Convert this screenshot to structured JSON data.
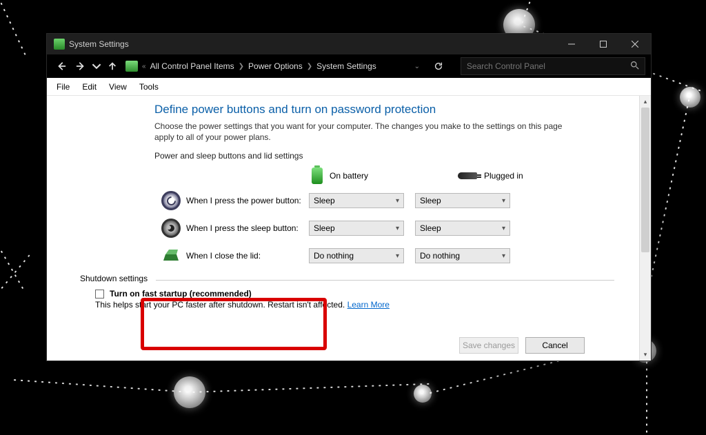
{
  "window": {
    "title": "System Settings"
  },
  "breadcrumb": {
    "items": [
      "All Control Panel Items",
      "Power Options",
      "System Settings"
    ]
  },
  "search": {
    "placeholder": "Search Control Panel"
  },
  "menu": {
    "file": "File",
    "edit": "Edit",
    "view": "View",
    "tools": "Tools"
  },
  "page": {
    "heading": "Define power buttons and turn on password protection",
    "description": "Choose the power settings that you want for your computer. The changes you make to the settings on this page apply to all of your power plans.",
    "section_label": "Power and sleep buttons and lid settings",
    "col_battery": "On battery",
    "col_plugged": "Plugged in",
    "rows": [
      {
        "label": "When I press the power button:",
        "battery": "Sleep",
        "plugged": "Sleep"
      },
      {
        "label": "When I press the sleep button:",
        "battery": "Sleep",
        "plugged": "Sleep"
      },
      {
        "label": "When I close the lid:",
        "battery": "Do nothing",
        "plugged": "Do nothing"
      }
    ],
    "shutdown": {
      "title": "Shutdown settings",
      "fast_startup_label": "Turn on fast startup (recommended)",
      "fast_startup_help": "This helps start your PC faster after shutdown. Restart isn't affected. ",
      "learn_more": "Learn More"
    },
    "buttons": {
      "save": "Save changes",
      "cancel": "Cancel"
    }
  }
}
